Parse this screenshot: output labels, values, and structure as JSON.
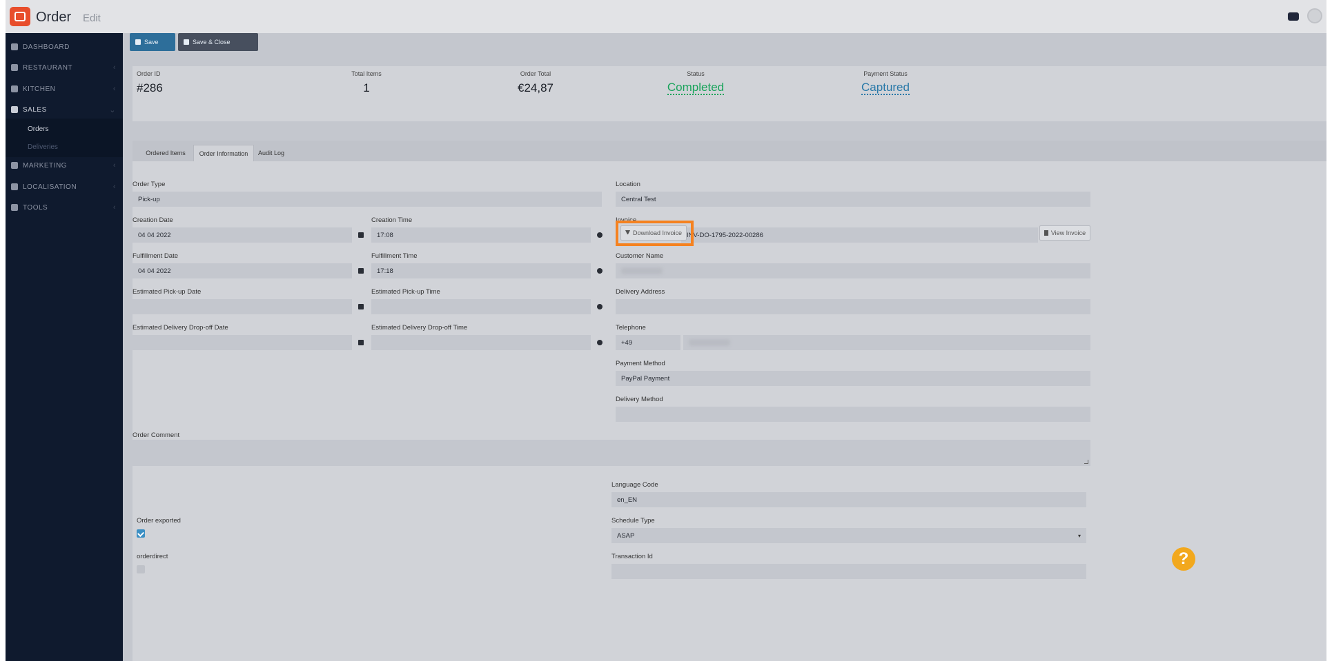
{
  "header": {
    "title": "Order",
    "subtitle": "Edit"
  },
  "sidebar": {
    "items": [
      {
        "label": "DASHBOARD"
      },
      {
        "label": "RESTAURANT"
      },
      {
        "label": "KITCHEN"
      },
      {
        "label": "SALES"
      },
      {
        "label": "MARKETING"
      },
      {
        "label": "LOCALISATION"
      },
      {
        "label": "TOOLS"
      }
    ],
    "sales_sub": [
      "Orders",
      "Deliveries"
    ]
  },
  "toolbar": {
    "save_label": "Save",
    "save_close_label": "Save & Close"
  },
  "summary": {
    "order_id_label": "Order ID",
    "order_id": "#286",
    "total_items_label": "Total Items",
    "total_items": "1",
    "order_total_label": "Order Total",
    "order_total": "€24,87",
    "status_label": "Status",
    "status": "Completed",
    "payment_status_label": "Payment Status",
    "payment_status": "Captured"
  },
  "tabs": [
    "Ordered Items",
    "Order Information",
    "Audit Log"
  ],
  "form": {
    "order_type_label": "Order Type",
    "order_type": "Pick-up",
    "location_label": "Location",
    "location": "Central Test",
    "creation_date_label": "Creation Date",
    "creation_date": "04 04 2022",
    "creation_time_label": "Creation Time",
    "creation_time": "17:08",
    "invoice_label": "Invoice",
    "download_invoice": "Download Invoice",
    "invoice_number": "INV-DO-1795-2022-00286",
    "view_invoice": "View Invoice",
    "fulfillment_date_label": "Fulfillment Date",
    "fulfillment_date": "04 04 2022",
    "fulfillment_time_label": "Fulfillment Time",
    "fulfillment_time": "17:18",
    "customer_name_label": "Customer Name",
    "est_pickup_date_label": "Estimated Pick-up Date",
    "est_pickup_time_label": "Estimated Pick-up Time",
    "delivery_address_label": "Delivery Address",
    "est_dropoff_date_label": "Estimated Delivery Drop-off Date",
    "est_dropoff_time_label": "Estimated Delivery Drop-off Time",
    "telephone_label": "Telephone",
    "telephone_prefix": "+49",
    "payment_method_label": "Payment Method",
    "payment_method": "PayPal Payment",
    "delivery_method_label": "Delivery Method",
    "order_comment_label": "Order Comment",
    "language_code_label": "Language Code",
    "language_code": "en_EN",
    "order_exported_label": "Order exported",
    "schedule_type_label": "Schedule Type",
    "schedule_type": "ASAP",
    "orderdirect_label": "orderdirect",
    "transaction_id_label": "Transaction Id"
  },
  "help_label": "?"
}
